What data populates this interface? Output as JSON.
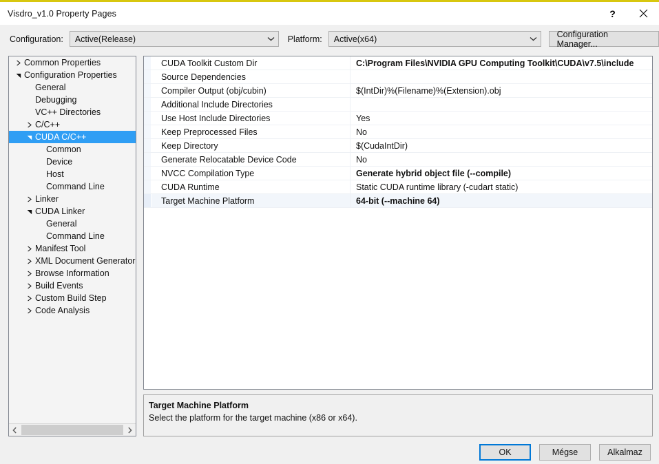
{
  "window": {
    "title": "Visdro_v1.0 Property Pages",
    "help_icon": "question-mark-icon",
    "help_label": "?",
    "close_icon": "close-icon",
    "accent_color": "#d8c70f"
  },
  "config_bar": {
    "configuration_label": "Configuration:",
    "configuration_value": "Active(Release)",
    "platform_label": "Platform:",
    "platform_value": "Active(x64)",
    "configuration_manager_label": "Configuration Manager...",
    "chevron_icon": "chevron-down-icon"
  },
  "tree": {
    "selection_color": "#2f9ef4",
    "items": [
      {
        "label": "Common Properties",
        "indent": 0,
        "arrow": "collapsed",
        "selected": false
      },
      {
        "label": "Configuration Properties",
        "indent": 0,
        "arrow": "expanded",
        "selected": false
      },
      {
        "label": "General",
        "indent": 1,
        "arrow": "none",
        "selected": false
      },
      {
        "label": "Debugging",
        "indent": 1,
        "arrow": "none",
        "selected": false
      },
      {
        "label": "VC++ Directories",
        "indent": 1,
        "arrow": "none",
        "selected": false
      },
      {
        "label": "C/C++",
        "indent": 1,
        "arrow": "collapsed",
        "selected": false
      },
      {
        "label": "CUDA C/C++",
        "indent": 1,
        "arrow": "expanded",
        "selected": true
      },
      {
        "label": "Common",
        "indent": 2,
        "arrow": "none",
        "selected": false
      },
      {
        "label": "Device",
        "indent": 2,
        "arrow": "none",
        "selected": false
      },
      {
        "label": "Host",
        "indent": 2,
        "arrow": "none",
        "selected": false
      },
      {
        "label": "Command Line",
        "indent": 2,
        "arrow": "none",
        "selected": false
      },
      {
        "label": "Linker",
        "indent": 1,
        "arrow": "collapsed",
        "selected": false
      },
      {
        "label": "CUDA Linker",
        "indent": 1,
        "arrow": "expanded",
        "selected": false
      },
      {
        "label": "General",
        "indent": 2,
        "arrow": "none",
        "selected": false
      },
      {
        "label": "Command Line",
        "indent": 2,
        "arrow": "none",
        "selected": false
      },
      {
        "label": "Manifest Tool",
        "indent": 1,
        "arrow": "collapsed",
        "selected": false
      },
      {
        "label": "XML Document Generator",
        "indent": 1,
        "arrow": "collapsed",
        "selected": false
      },
      {
        "label": "Browse Information",
        "indent": 1,
        "arrow": "collapsed",
        "selected": false
      },
      {
        "label": "Build Events",
        "indent": 1,
        "arrow": "collapsed",
        "selected": false
      },
      {
        "label": "Custom Build Step",
        "indent": 1,
        "arrow": "collapsed",
        "selected": false
      },
      {
        "label": "Code Analysis",
        "indent": 1,
        "arrow": "collapsed",
        "selected": false
      }
    ],
    "scrollbar": {
      "left_arrow_icon": "chevron-left-icon",
      "right_arrow_icon": "chevron-right-icon"
    }
  },
  "grid": {
    "rows": [
      {
        "name": "CUDA Toolkit Custom Dir",
        "value": "C:\\Program Files\\NVIDIA GPU Computing Toolkit\\CUDA\\v7.5\\include",
        "bold": true,
        "selected": false
      },
      {
        "name": "Source Dependencies",
        "value": "",
        "bold": false,
        "selected": false
      },
      {
        "name": "Compiler Output (obj/cubin)",
        "value": "$(IntDir)%(Filename)%(Extension).obj",
        "bold": false,
        "selected": false
      },
      {
        "name": "Additional Include Directories",
        "value": "",
        "bold": false,
        "selected": false
      },
      {
        "name": "Use Host Include Directories",
        "value": "Yes",
        "bold": false,
        "selected": false
      },
      {
        "name": "Keep Preprocessed Files",
        "value": "No",
        "bold": false,
        "selected": false
      },
      {
        "name": "Keep Directory",
        "value": "$(CudaIntDir)",
        "bold": false,
        "selected": false
      },
      {
        "name": "Generate Relocatable Device Code",
        "value": "No",
        "bold": false,
        "selected": false
      },
      {
        "name": "NVCC Compilation Type",
        "value": "Generate hybrid object file (--compile)",
        "bold": true,
        "selected": false
      },
      {
        "name": "CUDA Runtime",
        "value": "Static CUDA runtime library (-cudart static)",
        "bold": false,
        "selected": false
      },
      {
        "name": "Target Machine Platform",
        "value": "64-bit (--machine 64)",
        "bold": true,
        "selected": true
      }
    ]
  },
  "description": {
    "title": "Target Machine Platform",
    "body": "Select the platform for the target machine (x86 or x64)."
  },
  "footer": {
    "ok_label": "OK",
    "cancel_label": "Mégse",
    "apply_label": "Alkalmaz",
    "focus_color": "#0078d7"
  }
}
